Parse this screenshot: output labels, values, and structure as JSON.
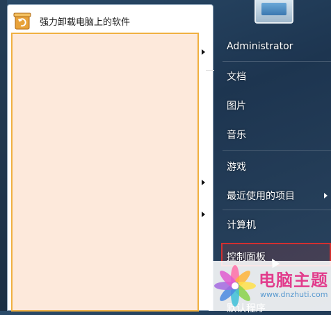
{
  "start_menu": {
    "left": {
      "pinned": {
        "label": "强力卸载电脑上的软件",
        "icon": "uninstaller-icon"
      },
      "highlight_border_color": "#f0b040",
      "highlight_fill_color": "#fde9db"
    },
    "right": {
      "user_name": "Administrator",
      "items": [
        {
          "label": "文档"
        },
        {
          "label": "图片"
        },
        {
          "label": "音乐"
        },
        {
          "label": "游戏"
        },
        {
          "label": "最近使用的项目",
          "submenu": true
        },
        {
          "label": "计算机"
        },
        {
          "label": "控制面板",
          "selected": true
        },
        {
          "label": "默认程序"
        }
      ],
      "selected_border_color": "#d23030"
    }
  },
  "watermark": {
    "title": "电脑主题",
    "url": "www.dnzhuti.com",
    "title_color": "#e23c8c"
  }
}
